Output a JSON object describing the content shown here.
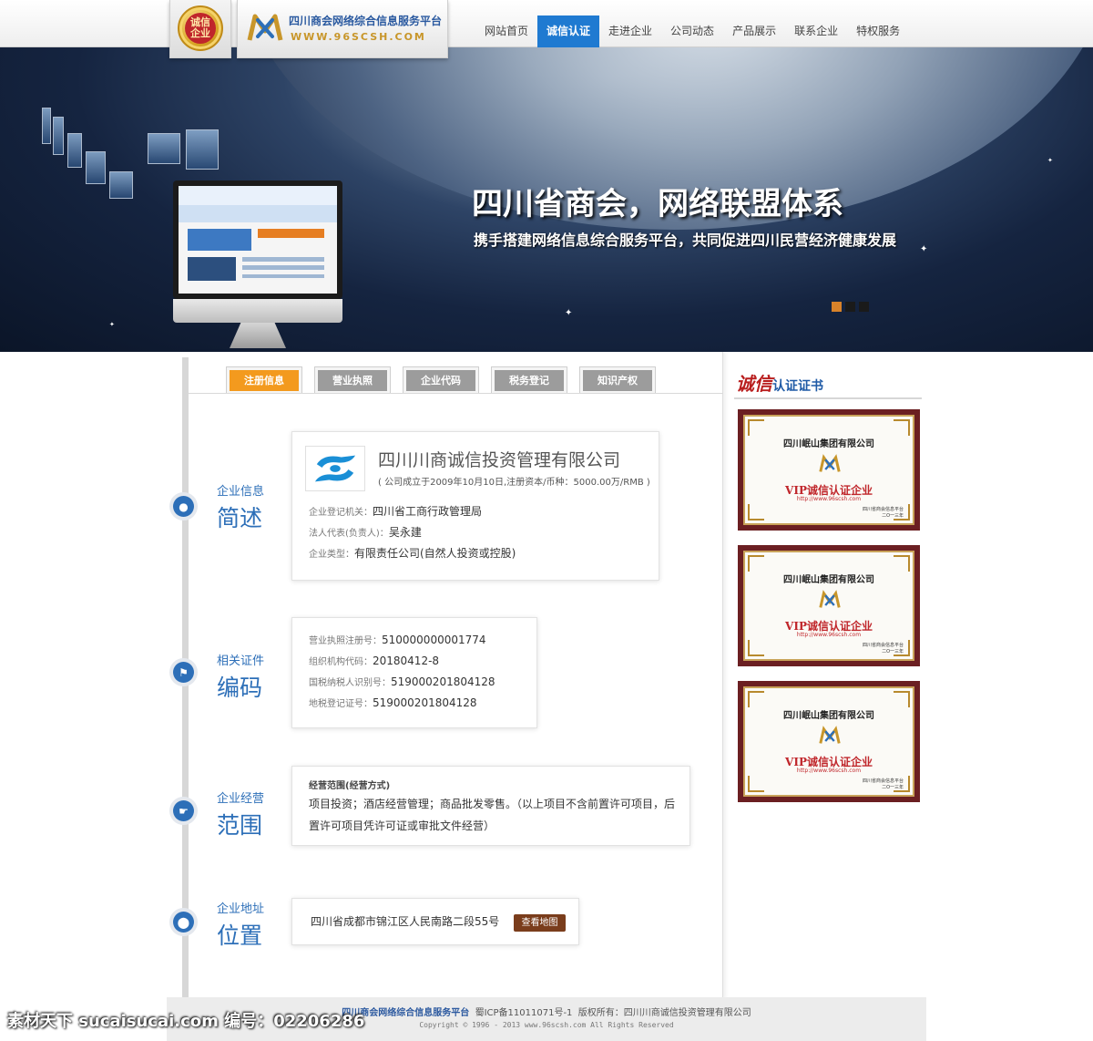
{
  "header": {
    "seal_text": [
      "诚信",
      "企业"
    ],
    "site_title": "四川商会网络综合信息服务平台",
    "site_url": "WWW.96SCSH.COM",
    "nav": [
      "网站首页",
      "诚信认证",
      "走进企业",
      "公司动态",
      "产品展示",
      "联系企业",
      "特权服务"
    ],
    "nav_active_index": 1
  },
  "banner": {
    "title": "四川省商会，网络联盟体系",
    "subtitle": "携手搭建网络信息综合服务平台，共同促进四川民营经济健康发展",
    "slide_count": 3,
    "active_slide": 0
  },
  "tabs": [
    "注册信息",
    "营业执照",
    "企业代码",
    "税务登记",
    "知识产权"
  ],
  "sections": {
    "summary": {
      "small": "企业信息",
      "big": "简述",
      "company_name": "四川川商诚信投资管理有限公司",
      "company_note": "( 公司成立于2009年10月10日,注册资本/币种：5000.00万/RMB )",
      "rows": [
        {
          "key": "企业登记机关：",
          "value": "四川省工商行政管理局"
        },
        {
          "key": "法人代表(负责人)：",
          "value": "吴永建"
        },
        {
          "key": "企业类型：",
          "value": "有限责任公司(自然人投资或控股)"
        }
      ]
    },
    "codes": {
      "small": "相关证件",
      "big": "编码",
      "rows": [
        {
          "key": "营业执照注册号：",
          "value": "510000000001774"
        },
        {
          "key": "组织机构代码：",
          "value": "20180412-8"
        },
        {
          "key": "国税纳税人识别号：",
          "value": "519000201804128"
        },
        {
          "key": "地税登记证号：",
          "value": "519000201804128"
        }
      ]
    },
    "scope": {
      "small": "企业经营",
      "big": "范围",
      "heading": "经营范围(经营方式)",
      "text": "项目投资；酒店经营管理；商品批发零售。（以上项目不含前置许可项目，后置许可项目凭许可证或审批文件经营）"
    },
    "location": {
      "small": "企业地址",
      "big": "位置",
      "address": "四川省成都市锦江区人民南路二段55号",
      "map_button": "查看地图"
    }
  },
  "sidebar": {
    "title_script": "诚信",
    "title_rest": "认证证书",
    "certificates": [
      {
        "company": "四川岷山集团有限公司",
        "award": "VIP诚信认证企业",
        "url": "http://www.96scsh.com",
        "issuer": "四川省商会信息平台",
        "year": "二O一三年"
      },
      {
        "company": "四川岷山集团有限公司",
        "award": "VIP诚信认证企业",
        "url": "http://www.96scsh.com",
        "issuer": "四川省商会信息平台",
        "year": "二O一三年"
      },
      {
        "company": "四川岷山集团有限公司",
        "award": "VIP诚信认证企业",
        "url": "http://www.96scsh.com",
        "issuer": "四川省商会信息平台",
        "year": "二O一三年"
      }
    ]
  },
  "footer": {
    "site": "四川商会网络综合信息服务平台",
    "icp": "蜀ICP备11011071号-1",
    "owner": "版权所有：四川川商诚信投资管理有限公司",
    "copyright": "Copyright © 1996 - 2013 www.96scsh.com All Rights Reserved"
  },
  "watermark": {
    "text": "素材天下 sucaisucai.com  编号：02206286"
  },
  "colors": {
    "brand_blue": "#1f7ad1",
    "label_blue": "#2d6fb8",
    "tab_active": "#f39a1e",
    "tab_idle": "#9c9c9c",
    "cert_frame": "#6b1f22",
    "cert_red": "#c0262b"
  }
}
